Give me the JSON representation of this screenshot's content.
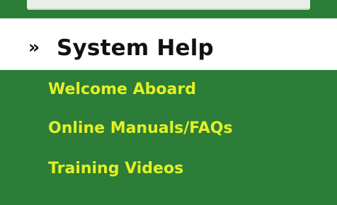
{
  "header": {
    "chevron": "»",
    "title": "System Help"
  },
  "menu": {
    "items": [
      {
        "label": "Welcome Aboard"
      },
      {
        "label": "Online Manuals/FAQs"
      },
      {
        "label": "Training Videos"
      }
    ]
  },
  "colors": {
    "panel_green": "#2b7d37",
    "link_yellow": "#e4f224",
    "header_bg": "#ffffff",
    "header_text": "#111111"
  }
}
